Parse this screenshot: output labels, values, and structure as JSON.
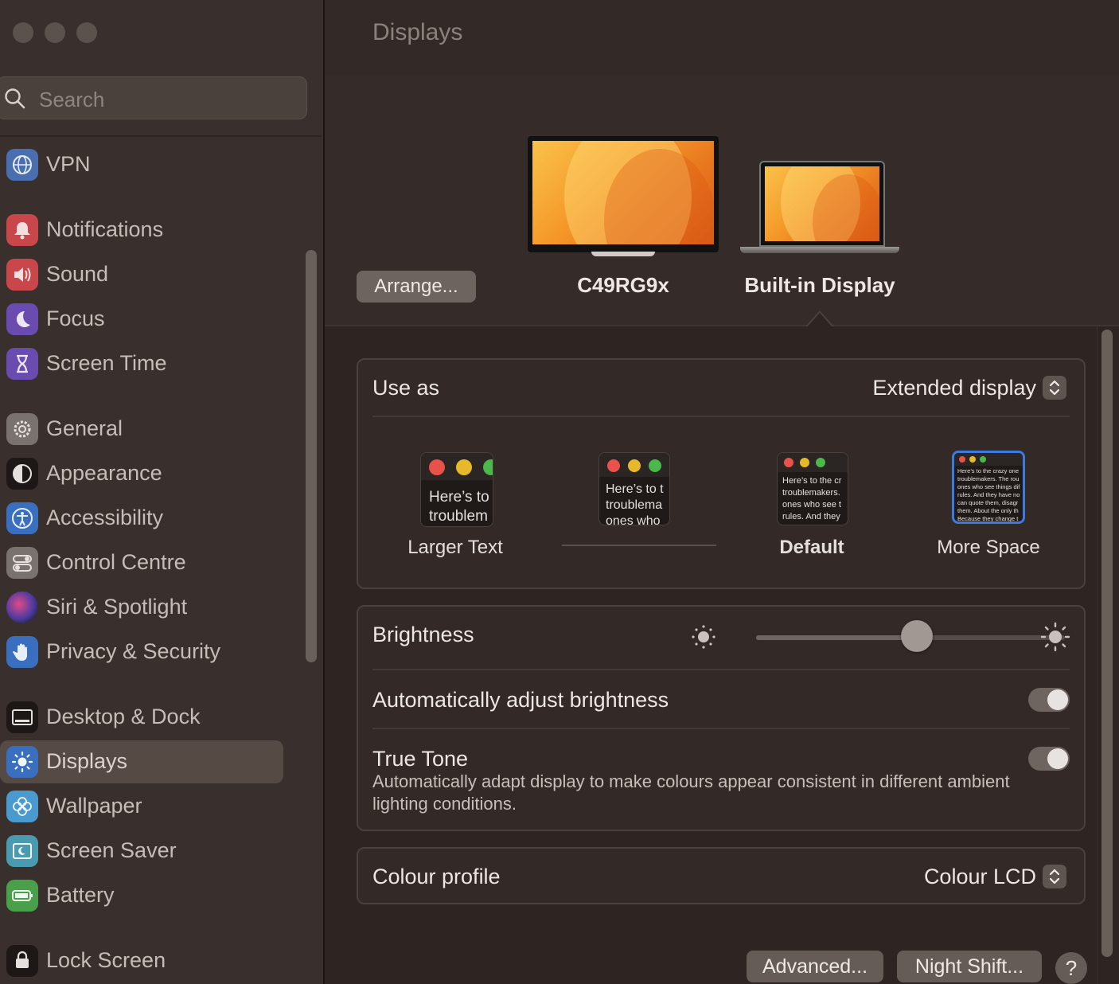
{
  "sidebar": {
    "search_placeholder": "Search",
    "items": [
      {
        "id": "vpn",
        "label": "VPN",
        "icon": "globe-icon",
        "color": "#4a6fb0"
      },
      {
        "id": "notifications",
        "label": "Notifications",
        "icon": "bell-icon",
        "color": "#c9474a"
      },
      {
        "id": "sound",
        "label": "Sound",
        "icon": "speaker-icon",
        "color": "#c9474a"
      },
      {
        "id": "focus",
        "label": "Focus",
        "icon": "moon-icon",
        "color": "#6a4bb0"
      },
      {
        "id": "screen-time",
        "label": "Screen Time",
        "icon": "hourglass-icon",
        "color": "#6a4bb0"
      },
      {
        "id": "general",
        "label": "General",
        "icon": "gear-icon",
        "color": "#7a726e"
      },
      {
        "id": "appearance",
        "label": "Appearance",
        "icon": "appearance-icon",
        "color": "#1d1816"
      },
      {
        "id": "accessibility",
        "label": "Accessibility",
        "icon": "accessibility-icon",
        "color": "#3a6fc0"
      },
      {
        "id": "control-centre",
        "label": "Control Centre",
        "icon": "toggles-icon",
        "color": "#7a726e"
      },
      {
        "id": "siri-spotlight",
        "label": "Siri & Spotlight",
        "icon": "siri-icon",
        "color": "#503080"
      },
      {
        "id": "privacy-security",
        "label": "Privacy & Security",
        "icon": "hand-icon",
        "color": "#3a6fc0"
      },
      {
        "id": "desktop-dock",
        "label": "Desktop & Dock",
        "icon": "dock-icon",
        "color": "#1d1816"
      },
      {
        "id": "displays",
        "label": "Displays",
        "icon": "sun-icon",
        "color": "#3a6fc0",
        "active": true
      },
      {
        "id": "wallpaper",
        "label": "Wallpaper",
        "icon": "flower-icon",
        "color": "#4a9ad0"
      },
      {
        "id": "screen-saver",
        "label": "Screen Saver",
        "icon": "screensaver-icon",
        "color": "#4a9ab0"
      },
      {
        "id": "battery",
        "label": "Battery",
        "icon": "battery-icon",
        "color": "#4aa04a"
      },
      {
        "id": "lock-screen",
        "label": "Lock Screen",
        "icon": "lock-icon",
        "color": "#1d1816"
      }
    ]
  },
  "header": {
    "title": "Displays"
  },
  "displays": {
    "arrange_label": "Arrange...",
    "external": "C49RG9x",
    "builtin": "Built-in Display"
  },
  "use_as": {
    "label": "Use as",
    "value": "Extended display"
  },
  "resolution": {
    "options": [
      {
        "label": "Larger Text",
        "sample": "Here’s to\ntroublem",
        "selected": false
      },
      {
        "label": "",
        "sample": "Here’s to t\ntroublema\nones who",
        "selected": false
      },
      {
        "label": "Default",
        "sample": "Here’s to the cr\ntroublemakers.\nones who see t\nrules. And they",
        "selected": false
      },
      {
        "label": "More Space",
        "sample": "Here’s to the crazy one\ntroublemakers. The rou\nones who see things dif\nrules. And they have no\ncan quote them, disagr\nthem. About the only th\nBecause they change t",
        "selected": true
      }
    ]
  },
  "brightness": {
    "label": "Brightness",
    "level": 0.52
  },
  "auto_brightness": {
    "label": "Automatically adjust brightness",
    "on": true
  },
  "true_tone": {
    "label": "True Tone",
    "description": "Automatically adapt display to make colours appear consistent in different ambient lighting conditions.",
    "on": true
  },
  "colour_profile": {
    "label": "Colour profile",
    "value": "Colour LCD"
  },
  "footer": {
    "advanced_label": "Advanced...",
    "night_shift_label": "Night Shift...",
    "help_label": "?"
  }
}
